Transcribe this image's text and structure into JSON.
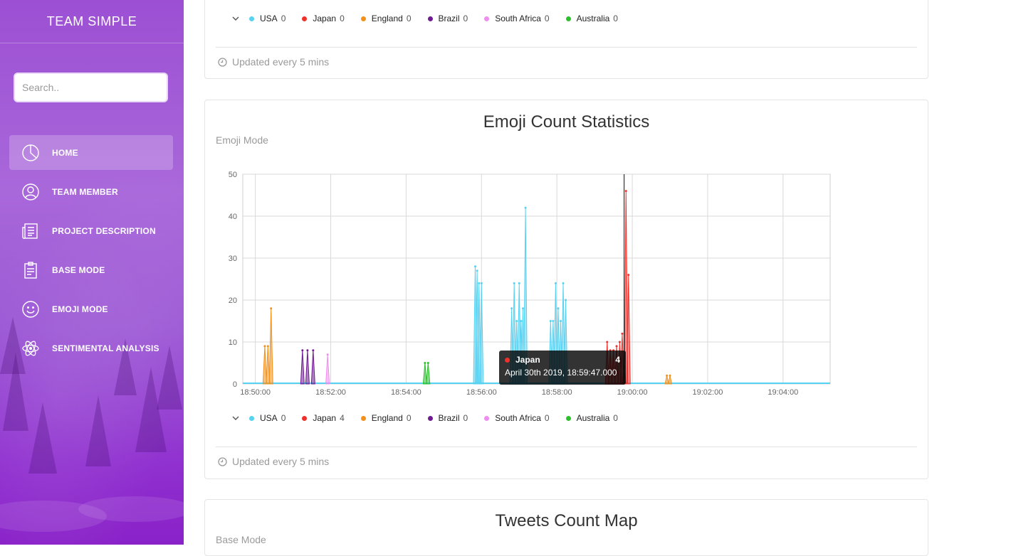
{
  "sidebar": {
    "brand": "TEAM SIMPLE",
    "search_placeholder": "Search..",
    "items": [
      {
        "label": "HOME",
        "icon": "pie-chart-icon",
        "active": true
      },
      {
        "label": "TEAM MEMBER",
        "icon": "user-icon"
      },
      {
        "label": "PROJECT DESCRIPTION",
        "icon": "newspaper-icon"
      },
      {
        "label": "BASE MODE",
        "icon": "clipboard-icon"
      },
      {
        "label": "EMOJI MODE",
        "icon": "smile-icon"
      },
      {
        "label": "SENTIMENTAL ANALYSIS",
        "icon": "atom-icon"
      }
    ]
  },
  "colors": {
    "usa": "#56d2f2",
    "japan": "#f0302a",
    "england": "#f39019",
    "brazil": "#6f1b91",
    "south_africa": "#f08ef0",
    "australia": "#2bbf2b",
    "sidebar_accent": "#9a3fd4"
  },
  "top_card": {
    "legend": [
      {
        "name": "USA",
        "value": "0"
      },
      {
        "name": "Japan",
        "value": "0"
      },
      {
        "name": "England",
        "value": "0"
      },
      {
        "name": "Brazil",
        "value": "0"
      },
      {
        "name": "South Africa",
        "value": "0"
      },
      {
        "name": "Australia",
        "value": "0"
      }
    ],
    "footer": "Updated every 5 mins"
  },
  "emoji_card": {
    "title": "Emoji Count Statistics",
    "subtitle": "Emoji Mode",
    "legend": [
      {
        "name": "USA",
        "value": "0"
      },
      {
        "name": "Japan",
        "value": "4"
      },
      {
        "name": "England",
        "value": "0"
      },
      {
        "name": "Brazil",
        "value": "0"
      },
      {
        "name": "South Africa",
        "value": "0"
      },
      {
        "name": "Australia",
        "value": "0"
      }
    ],
    "footer": "Updated every 5 mins",
    "tooltip": {
      "series": "Japan",
      "value": "4",
      "time": "April 30th 2019, 18:59:47.000"
    }
  },
  "map_card": {
    "title": "Tweets Count Map",
    "subtitle": "Base Mode"
  },
  "chart_data": {
    "type": "area",
    "xlabel": "",
    "ylabel": "",
    "x_range_minutes": [
      "18:49:40",
      "19:05:15"
    ],
    "ylim": [
      0,
      50
    ],
    "y_ticks": [
      0,
      10,
      20,
      30,
      40,
      50
    ],
    "x_ticks": [
      "18:50:00",
      "18:52:00",
      "18:54:00",
      "18:56:00",
      "18:58:00",
      "19:00:00",
      "19:02:00",
      "19:04:00"
    ],
    "grid": true,
    "cursor_time": "18:59:47",
    "series": [
      {
        "name": "England",
        "color": "#f39019",
        "points": [
          [
            "18:50:15",
            9
          ],
          [
            "18:50:20",
            9
          ],
          [
            "18:50:25",
            18
          ],
          [
            "18:51:00",
            0
          ],
          [
            "19:00:55",
            2
          ],
          [
            "19:01:00",
            2
          ]
        ]
      },
      {
        "name": "Brazil",
        "color": "#6f1b91",
        "points": [
          [
            "18:51:15",
            8
          ],
          [
            "18:51:23",
            8
          ],
          [
            "18:51:32",
            8
          ]
        ]
      },
      {
        "name": "South Africa",
        "color": "#f08ef0",
        "points": [
          [
            "18:51:55",
            7
          ]
        ]
      },
      {
        "name": "Australia",
        "color": "#2bbf2b",
        "points": [
          [
            "18:54:30",
            5
          ],
          [
            "18:54:35",
            5
          ]
        ]
      },
      {
        "name": "USA",
        "color": "#56d2f2",
        "points": [
          [
            "18:55:50",
            28
          ],
          [
            "18:55:53",
            27
          ],
          [
            "18:55:56",
            24
          ],
          [
            "18:56:00",
            24
          ],
          [
            "18:56:48",
            18
          ],
          [
            "18:56:52",
            24
          ],
          [
            "18:56:56",
            15
          ],
          [
            "18:57:00",
            24
          ],
          [
            "18:57:03",
            15
          ],
          [
            "18:57:06",
            18
          ],
          [
            "18:57:10",
            42
          ],
          [
            "18:57:50",
            15
          ],
          [
            "18:57:54",
            15
          ],
          [
            "18:57:58",
            24
          ],
          [
            "18:58:02",
            18
          ],
          [
            "18:58:06",
            15
          ],
          [
            "18:58:10",
            24
          ],
          [
            "18:58:14",
            20
          ]
        ]
      },
      {
        "name": "Japan",
        "color": "#f0302a",
        "points": [
          [
            "18:59:20",
            10
          ],
          [
            "18:59:25",
            8
          ],
          [
            "18:59:30",
            8
          ],
          [
            "18:59:35",
            9
          ],
          [
            "18:59:40",
            10
          ],
          [
            "18:59:44",
            12
          ],
          [
            "18:59:47",
            4
          ],
          [
            "18:59:50",
            46
          ],
          [
            "18:59:54",
            26
          ]
        ]
      }
    ]
  }
}
